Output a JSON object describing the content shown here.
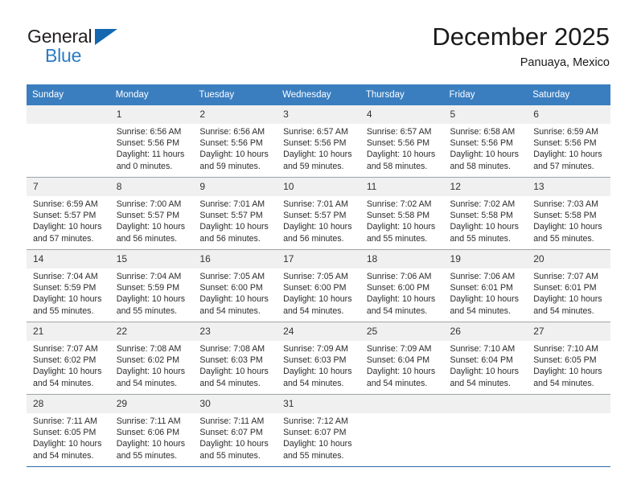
{
  "brand": {
    "name_top": "General",
    "name_bottom": "Blue"
  },
  "header": {
    "title": "December 2025",
    "subtitle": "Panuaya, Mexico"
  },
  "colors": {
    "header_blue": "#3a7ec0",
    "brand_blue": "#2b7cc4",
    "daynum_band": "#f0f0f0",
    "row_divider": "#9fa3a6"
  },
  "weekdays": [
    "Sunday",
    "Monday",
    "Tuesday",
    "Wednesday",
    "Thursday",
    "Friday",
    "Saturday"
  ],
  "weeks": [
    [
      {
        "day": "",
        "sunrise": "",
        "sunset": "",
        "daylight1": "",
        "daylight2": ""
      },
      {
        "day": "1",
        "sunrise": "Sunrise: 6:56 AM",
        "sunset": "Sunset: 5:56 PM",
        "daylight1": "Daylight: 11 hours",
        "daylight2": "and 0 minutes."
      },
      {
        "day": "2",
        "sunrise": "Sunrise: 6:56 AM",
        "sunset": "Sunset: 5:56 PM",
        "daylight1": "Daylight: 10 hours",
        "daylight2": "and 59 minutes."
      },
      {
        "day": "3",
        "sunrise": "Sunrise: 6:57 AM",
        "sunset": "Sunset: 5:56 PM",
        "daylight1": "Daylight: 10 hours",
        "daylight2": "and 59 minutes."
      },
      {
        "day": "4",
        "sunrise": "Sunrise: 6:57 AM",
        "sunset": "Sunset: 5:56 PM",
        "daylight1": "Daylight: 10 hours",
        "daylight2": "and 58 minutes."
      },
      {
        "day": "5",
        "sunrise": "Sunrise: 6:58 AM",
        "sunset": "Sunset: 5:56 PM",
        "daylight1": "Daylight: 10 hours",
        "daylight2": "and 58 minutes."
      },
      {
        "day": "6",
        "sunrise": "Sunrise: 6:59 AM",
        "sunset": "Sunset: 5:56 PM",
        "daylight1": "Daylight: 10 hours",
        "daylight2": "and 57 minutes."
      }
    ],
    [
      {
        "day": "7",
        "sunrise": "Sunrise: 6:59 AM",
        "sunset": "Sunset: 5:57 PM",
        "daylight1": "Daylight: 10 hours",
        "daylight2": "and 57 minutes."
      },
      {
        "day": "8",
        "sunrise": "Sunrise: 7:00 AM",
        "sunset": "Sunset: 5:57 PM",
        "daylight1": "Daylight: 10 hours",
        "daylight2": "and 56 minutes."
      },
      {
        "day": "9",
        "sunrise": "Sunrise: 7:01 AM",
        "sunset": "Sunset: 5:57 PM",
        "daylight1": "Daylight: 10 hours",
        "daylight2": "and 56 minutes."
      },
      {
        "day": "10",
        "sunrise": "Sunrise: 7:01 AM",
        "sunset": "Sunset: 5:57 PM",
        "daylight1": "Daylight: 10 hours",
        "daylight2": "and 56 minutes."
      },
      {
        "day": "11",
        "sunrise": "Sunrise: 7:02 AM",
        "sunset": "Sunset: 5:58 PM",
        "daylight1": "Daylight: 10 hours",
        "daylight2": "and 55 minutes."
      },
      {
        "day": "12",
        "sunrise": "Sunrise: 7:02 AM",
        "sunset": "Sunset: 5:58 PM",
        "daylight1": "Daylight: 10 hours",
        "daylight2": "and 55 minutes."
      },
      {
        "day": "13",
        "sunrise": "Sunrise: 7:03 AM",
        "sunset": "Sunset: 5:58 PM",
        "daylight1": "Daylight: 10 hours",
        "daylight2": "and 55 minutes."
      }
    ],
    [
      {
        "day": "14",
        "sunrise": "Sunrise: 7:04 AM",
        "sunset": "Sunset: 5:59 PM",
        "daylight1": "Daylight: 10 hours",
        "daylight2": "and 55 minutes."
      },
      {
        "day": "15",
        "sunrise": "Sunrise: 7:04 AM",
        "sunset": "Sunset: 5:59 PM",
        "daylight1": "Daylight: 10 hours",
        "daylight2": "and 55 minutes."
      },
      {
        "day": "16",
        "sunrise": "Sunrise: 7:05 AM",
        "sunset": "Sunset: 6:00 PM",
        "daylight1": "Daylight: 10 hours",
        "daylight2": "and 54 minutes."
      },
      {
        "day": "17",
        "sunrise": "Sunrise: 7:05 AM",
        "sunset": "Sunset: 6:00 PM",
        "daylight1": "Daylight: 10 hours",
        "daylight2": "and 54 minutes."
      },
      {
        "day": "18",
        "sunrise": "Sunrise: 7:06 AM",
        "sunset": "Sunset: 6:00 PM",
        "daylight1": "Daylight: 10 hours",
        "daylight2": "and 54 minutes."
      },
      {
        "day": "19",
        "sunrise": "Sunrise: 7:06 AM",
        "sunset": "Sunset: 6:01 PM",
        "daylight1": "Daylight: 10 hours",
        "daylight2": "and 54 minutes."
      },
      {
        "day": "20",
        "sunrise": "Sunrise: 7:07 AM",
        "sunset": "Sunset: 6:01 PM",
        "daylight1": "Daylight: 10 hours",
        "daylight2": "and 54 minutes."
      }
    ],
    [
      {
        "day": "21",
        "sunrise": "Sunrise: 7:07 AM",
        "sunset": "Sunset: 6:02 PM",
        "daylight1": "Daylight: 10 hours",
        "daylight2": "and 54 minutes."
      },
      {
        "day": "22",
        "sunrise": "Sunrise: 7:08 AM",
        "sunset": "Sunset: 6:02 PM",
        "daylight1": "Daylight: 10 hours",
        "daylight2": "and 54 minutes."
      },
      {
        "day": "23",
        "sunrise": "Sunrise: 7:08 AM",
        "sunset": "Sunset: 6:03 PM",
        "daylight1": "Daylight: 10 hours",
        "daylight2": "and 54 minutes."
      },
      {
        "day": "24",
        "sunrise": "Sunrise: 7:09 AM",
        "sunset": "Sunset: 6:03 PM",
        "daylight1": "Daylight: 10 hours",
        "daylight2": "and 54 minutes."
      },
      {
        "day": "25",
        "sunrise": "Sunrise: 7:09 AM",
        "sunset": "Sunset: 6:04 PM",
        "daylight1": "Daylight: 10 hours",
        "daylight2": "and 54 minutes."
      },
      {
        "day": "26",
        "sunrise": "Sunrise: 7:10 AM",
        "sunset": "Sunset: 6:04 PM",
        "daylight1": "Daylight: 10 hours",
        "daylight2": "and 54 minutes."
      },
      {
        "day": "27",
        "sunrise": "Sunrise: 7:10 AM",
        "sunset": "Sunset: 6:05 PM",
        "daylight1": "Daylight: 10 hours",
        "daylight2": "and 54 minutes."
      }
    ],
    [
      {
        "day": "28",
        "sunrise": "Sunrise: 7:11 AM",
        "sunset": "Sunset: 6:05 PM",
        "daylight1": "Daylight: 10 hours",
        "daylight2": "and 54 minutes."
      },
      {
        "day": "29",
        "sunrise": "Sunrise: 7:11 AM",
        "sunset": "Sunset: 6:06 PM",
        "daylight1": "Daylight: 10 hours",
        "daylight2": "and 55 minutes."
      },
      {
        "day": "30",
        "sunrise": "Sunrise: 7:11 AM",
        "sunset": "Sunset: 6:07 PM",
        "daylight1": "Daylight: 10 hours",
        "daylight2": "and 55 minutes."
      },
      {
        "day": "31",
        "sunrise": "Sunrise: 7:12 AM",
        "sunset": "Sunset: 6:07 PM",
        "daylight1": "Daylight: 10 hours",
        "daylight2": "and 55 minutes."
      },
      {
        "day": "",
        "sunrise": "",
        "sunset": "",
        "daylight1": "",
        "daylight2": ""
      },
      {
        "day": "",
        "sunrise": "",
        "sunset": "",
        "daylight1": "",
        "daylight2": ""
      },
      {
        "day": "",
        "sunrise": "",
        "sunset": "",
        "daylight1": "",
        "daylight2": ""
      }
    ]
  ]
}
